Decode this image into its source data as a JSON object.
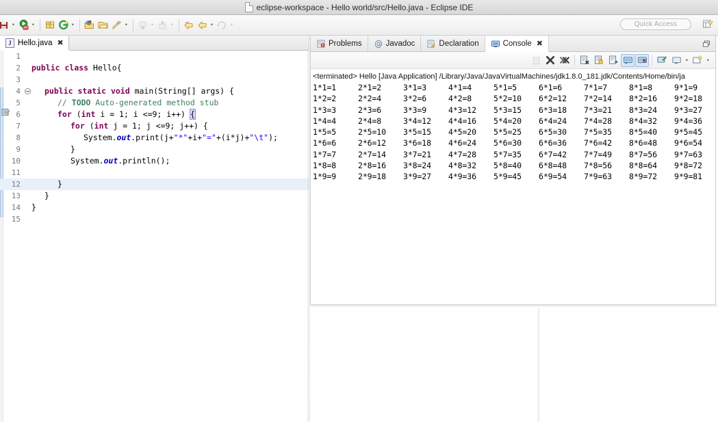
{
  "window": {
    "title": "eclipse-workspace - Hello world/src/Hello.java - Eclipse IDE",
    "doc_icon": "document-icon"
  },
  "toolbar": {
    "quick_access_placeholder": "Quick Access",
    "items": [
      {
        "name": "save-icon",
        "caret": true,
        "dim": false
      },
      {
        "name": "run-icon",
        "caret": true,
        "dim": false
      },
      {
        "name": "new-package-icon",
        "caret": false,
        "dim": false
      },
      {
        "name": "new-class-icon",
        "caret": true,
        "dim": false
      },
      {
        "name": "open-type-icon",
        "caret": false,
        "dim": false
      },
      {
        "name": "open-resource-icon",
        "caret": false,
        "dim": false
      },
      {
        "name": "search-icon",
        "caret": true,
        "dim": false
      },
      {
        "name": "next-annotation-icon",
        "caret": true,
        "dim": true
      },
      {
        "name": "previous-annotation-icon",
        "caret": true,
        "dim": true
      },
      {
        "name": "back-icon",
        "caret": false,
        "dim": false
      },
      {
        "name": "forward-icon",
        "caret": true,
        "dim": false
      },
      {
        "name": "last-edit-icon",
        "caret": true,
        "dim": true
      }
    ],
    "perspective_icon": "open-perspective-icon"
  },
  "editor": {
    "tab": {
      "label": "Hello.java",
      "icon": "java-file-icon",
      "close": "✖"
    },
    "lines": [
      {
        "num": "1",
        "fold": false,
        "highlight": false,
        "indent": 0,
        "tokens": []
      },
      {
        "num": "2",
        "fold": false,
        "highlight": false,
        "indent": 0,
        "tokens": [
          {
            "t": "public ",
            "c": "kw"
          },
          {
            "t": "class ",
            "c": "kw"
          },
          {
            "t": "Hello{",
            "c": "pln"
          }
        ]
      },
      {
        "num": "3",
        "fold": false,
        "highlight": false,
        "indent": 0,
        "tokens": []
      },
      {
        "num": "4",
        "fold": true,
        "highlight": false,
        "indent": 1,
        "tokens": [
          {
            "t": "public ",
            "c": "kw"
          },
          {
            "t": "static ",
            "c": "kw"
          },
          {
            "t": "void ",
            "c": "kw"
          },
          {
            "t": "main(String[] args) {",
            "c": "pln"
          }
        ]
      },
      {
        "num": "5",
        "fold": false,
        "highlight": false,
        "indent": 2,
        "tokens": [
          {
            "t": "// ",
            "c": "com"
          },
          {
            "t": "TODO",
            "c": "task"
          },
          {
            "t": " Auto-generated method stub",
            "c": "com"
          }
        ]
      },
      {
        "num": "6",
        "fold": false,
        "highlight": false,
        "indent": 2,
        "tokens": [
          {
            "t": "for ",
            "c": "kw"
          },
          {
            "t": "(",
            "c": "pln"
          },
          {
            "t": "int ",
            "c": "kw"
          },
          {
            "t": "i = 1; i <=9; i++) ",
            "c": "pln"
          },
          {
            "t": "{",
            "c": "brk"
          }
        ]
      },
      {
        "num": "7",
        "fold": false,
        "highlight": false,
        "indent": 3,
        "tokens": [
          {
            "t": "for ",
            "c": "kw"
          },
          {
            "t": "(",
            "c": "pln"
          },
          {
            "t": "int ",
            "c": "kw"
          },
          {
            "t": "j = 1; j <=9; j++) {",
            "c": "pln"
          }
        ]
      },
      {
        "num": "8",
        "fold": false,
        "highlight": false,
        "indent": 4,
        "tokens": [
          {
            "t": "System.",
            "c": "pln"
          },
          {
            "t": "out",
            "c": "fld"
          },
          {
            "t": ".print(j+",
            "c": "pln"
          },
          {
            "t": "\"*\"",
            "c": "str"
          },
          {
            "t": "+i+",
            "c": "pln"
          },
          {
            "t": "\"=\"",
            "c": "str"
          },
          {
            "t": "+(i*j)+",
            "c": "pln"
          },
          {
            "t": "\"\\t\"",
            "c": "str"
          },
          {
            "t": ");",
            "c": "pln"
          }
        ]
      },
      {
        "num": "9",
        "fold": false,
        "highlight": false,
        "indent": 3,
        "tokens": [
          {
            "t": "}",
            "c": "pln"
          }
        ]
      },
      {
        "num": "10",
        "fold": false,
        "highlight": false,
        "indent": 3,
        "tokens": [
          {
            "t": "System.",
            "c": "pln"
          },
          {
            "t": "out",
            "c": "fld"
          },
          {
            "t": ".println();",
            "c": "pln"
          }
        ]
      },
      {
        "num": "11",
        "fold": false,
        "highlight": false,
        "indent": 0,
        "tokens": []
      },
      {
        "num": "12",
        "fold": false,
        "highlight": true,
        "indent": 2,
        "tokens": [
          {
            "t": "}",
            "c": "pln"
          }
        ]
      },
      {
        "num": "13",
        "fold": false,
        "highlight": false,
        "indent": 1,
        "tokens": [
          {
            "t": "}",
            "c": "pln"
          }
        ]
      },
      {
        "num": "14",
        "fold": false,
        "highlight": false,
        "indent": 0,
        "tokens": [
          {
            "t": "}",
            "c": "pln"
          }
        ]
      },
      {
        "num": "15",
        "fold": false,
        "highlight": false,
        "indent": 0,
        "tokens": []
      }
    ]
  },
  "console_panel": {
    "tabs": [
      {
        "label": "Problems",
        "icon": "problems-icon",
        "active": false,
        "closeable": false
      },
      {
        "label": "Javadoc",
        "icon": "javadoc-icon",
        "active": false,
        "closeable": false
      },
      {
        "label": "Declaration",
        "icon": "declaration-icon",
        "active": false,
        "closeable": false
      },
      {
        "label": "Console",
        "icon": "console-icon",
        "active": true,
        "closeable": true
      }
    ],
    "tab_close_glyph": "✖",
    "restore_icon": "restore-panel-icon",
    "toolbar_buttons": [
      {
        "name": "scroll-lock-icon",
        "dim": true,
        "toggled": false
      },
      {
        "name": "terminate-icon",
        "dim": false,
        "toggled": false
      },
      {
        "name": "remove-all-terminated-icon",
        "dim": false,
        "toggled": false
      },
      {
        "name": "separator",
        "dim": false,
        "toggled": false
      },
      {
        "name": "clear-console-icon",
        "dim": false,
        "toggled": false
      },
      {
        "name": "scroll-lock-toggle-icon",
        "dim": false,
        "toggled": false
      },
      {
        "name": "word-wrap-icon",
        "dim": false,
        "toggled": false
      },
      {
        "name": "show-console-stdout-icon",
        "dim": false,
        "toggled": true
      },
      {
        "name": "show-console-stderr-icon",
        "dim": false,
        "toggled": true
      },
      {
        "name": "separator",
        "dim": false,
        "toggled": false
      },
      {
        "name": "pin-console-icon",
        "dim": false,
        "toggled": false
      },
      {
        "name": "display-selected-console-icon",
        "dim": false,
        "toggled": false,
        "caret": true
      },
      {
        "name": "open-console-icon",
        "dim": false,
        "toggled": false,
        "caret": true
      }
    ],
    "terminated_line": "<terminated> Hello [Java Application] /Library/Java/JavaVirtualMachines/jdk1.8.0_181.jdk/Contents/Home/bin/ja",
    "output_rows": [
      [
        "1*1=1",
        "2*1=2",
        "3*1=3",
        "4*1=4",
        "5*1=5",
        "6*1=6",
        "7*1=7",
        "8*1=8",
        "9*1=9"
      ],
      [
        "1*2=2",
        "2*2=4",
        "3*2=6",
        "4*2=8",
        "5*2=10",
        "6*2=12",
        "7*2=14",
        "8*2=16",
        "9*2=18"
      ],
      [
        "1*3=3",
        "2*3=6",
        "3*3=9",
        "4*3=12",
        "5*3=15",
        "6*3=18",
        "7*3=21",
        "8*3=24",
        "9*3=27"
      ],
      [
        "1*4=4",
        "2*4=8",
        "3*4=12",
        "4*4=16",
        "5*4=20",
        "6*4=24",
        "7*4=28",
        "8*4=32",
        "9*4=36"
      ],
      [
        "1*5=5",
        "2*5=10",
        "3*5=15",
        "4*5=20",
        "5*5=25",
        "6*5=30",
        "7*5=35",
        "8*5=40",
        "9*5=45"
      ],
      [
        "1*6=6",
        "2*6=12",
        "3*6=18",
        "4*6=24",
        "5*6=30",
        "6*6=36",
        "7*6=42",
        "8*6=48",
        "9*6=54"
      ],
      [
        "1*7=7",
        "2*7=14",
        "3*7=21",
        "4*7=28",
        "5*7=35",
        "6*7=42",
        "7*7=49",
        "8*7=56",
        "9*7=63"
      ],
      [
        "1*8=8",
        "2*8=16",
        "3*8=24",
        "4*8=32",
        "5*8=40",
        "6*8=48",
        "7*8=56",
        "8*8=64",
        "9*8=72"
      ],
      [
        "1*9=9",
        "2*9=18",
        "3*9=27",
        "4*9=36",
        "5*9=45",
        "6*9=54",
        "7*9=63",
        "8*9=72",
        "9*9=81"
      ]
    ]
  },
  "colors": {
    "keyword": "#7f0055",
    "string": "#2a00ff",
    "comment": "#3f7f5f",
    "field": "#0000c0",
    "selection": "#e8f0fb",
    "titlebar": "#dcdcdc"
  }
}
